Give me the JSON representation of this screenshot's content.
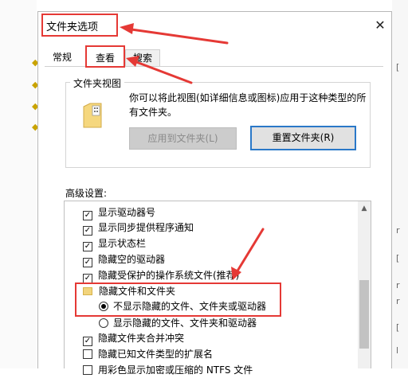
{
  "dialog": {
    "title": "文件夹选项",
    "close_glyph": "✕"
  },
  "tabs": [
    {
      "label": "常规",
      "active": false
    },
    {
      "label": "查看",
      "active": true
    },
    {
      "label": "搜索",
      "active": false
    }
  ],
  "folder_views": {
    "group_label": "文件夹视图",
    "description": "你可以将此视图(如详细信息或图标)应用于这种类型的所有文件夹。",
    "apply_button": "应用到文件夹(L)",
    "reset_button": "重置文件夹(R)"
  },
  "advanced": {
    "label": "高级设置:",
    "items": [
      {
        "type": "checkbox",
        "checked": true,
        "label": "显示驱动器号"
      },
      {
        "type": "checkbox",
        "checked": true,
        "label": "显示同步提供程序通知"
      },
      {
        "type": "checkbox",
        "checked": true,
        "label": "显示状态栏"
      },
      {
        "type": "checkbox",
        "checked": true,
        "label": "隐藏空的驱动器"
      },
      {
        "type": "checkbox",
        "checked": true,
        "label": "隐藏受保护的操作系统文件(推荐)"
      },
      {
        "type": "folder",
        "label": "隐藏文件和文件夹"
      },
      {
        "type": "radio",
        "checked": true,
        "label": "不显示隐藏的文件、文件夹或驱动器"
      },
      {
        "type": "radio",
        "checked": false,
        "label": "显示隐藏的文件、文件夹和驱动器"
      },
      {
        "type": "checkbox",
        "checked": true,
        "label": "隐藏文件夹合并冲突"
      },
      {
        "type": "checkbox",
        "checked": false,
        "label": "隐藏已知文件类型的扩展名"
      },
      {
        "type": "checkbox",
        "checked": false,
        "label": "用彩色显示加密或压缩的 NTFS 文件"
      }
    ]
  },
  "background": {
    "right_glyphs": [
      "[",
      "r",
      "[",
      "r",
      "r",
      "[",
      "l"
    ]
  },
  "colors": {
    "annotation": "#e53935",
    "focus_border": "#2a78c8"
  },
  "icons": {
    "close": "close-icon",
    "folder": "folder-icon",
    "scroll_up": "chevron-up-icon"
  }
}
